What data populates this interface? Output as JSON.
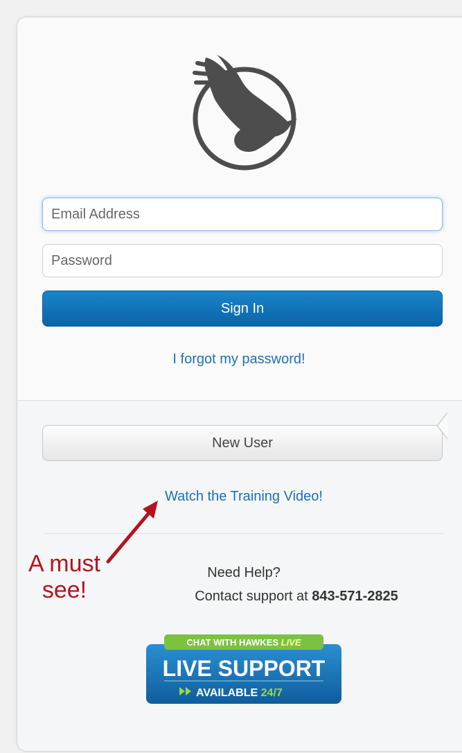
{
  "login": {
    "email_placeholder": "Email Address",
    "password_placeholder": "Password",
    "signin_label": "Sign In",
    "forgot_label": "I forgot my password!"
  },
  "onboarding": {
    "new_user_label": "New User",
    "training_link": "Watch the Training Video!"
  },
  "help": {
    "title": "Need Help?",
    "contact_prefix": "Contact support at ",
    "phone": "843-571-2825"
  },
  "annotation": {
    "line1": "A must",
    "line2": "see!"
  },
  "live_support_badge": {
    "top_text": "CHAT WITH HAWKES",
    "top_text_accent": "LIVE",
    "main_text": "LIVE SUPPORT",
    "bottom_text": "AVAILABLE",
    "bottom_text_accent": "24/7"
  },
  "colors": {
    "primary_button": "#0b64a8",
    "link": "#1d70b8",
    "annotation": "#b3141f",
    "badge_green": "#7cc242",
    "badge_blue": "#1a7cc1"
  },
  "icons": {
    "logo": "hawk-in-circle-logo",
    "arrow": "red-annotation-arrow"
  }
}
